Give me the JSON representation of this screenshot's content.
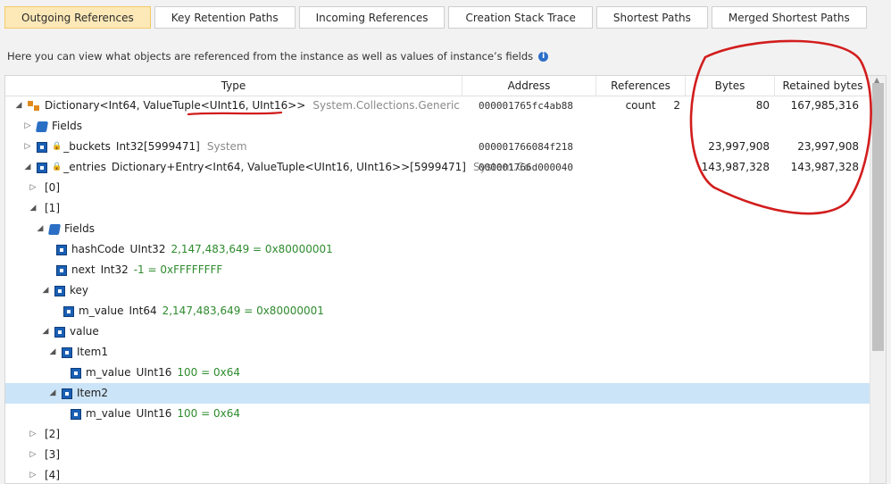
{
  "tabs": [
    {
      "label": "Outgoing References",
      "active": true
    },
    {
      "label": "Key Retention Paths",
      "active": false
    },
    {
      "label": "Incoming References",
      "active": false
    },
    {
      "label": "Creation Stack Trace",
      "active": false
    },
    {
      "label": "Shortest Paths",
      "active": false
    },
    {
      "label": "Merged Shortest Paths",
      "active": false
    }
  ],
  "description": "Here you can view what objects are referenced from the instance as well as values of instance’s fields",
  "info_icon": "i",
  "columns": {
    "type": "Type",
    "address": "Address",
    "refs": "References count",
    "bytes": "Bytes",
    "retained": "Retained bytes"
  },
  "rows": {
    "r0": {
      "name": "Dictionary<Int64, ValueTuple<UInt16, UInt16>>",
      "ns": "System.Collections.Generic",
      "address": "000001765fc4ab88",
      "refs": "2",
      "bytes": "80",
      "retained": "167,985,316"
    },
    "r1": {
      "name": "Fields"
    },
    "r2": {
      "name": "_buckets",
      "type": "Int32[5999471]",
      "ns": "System",
      "address": "000001766084f218",
      "bytes": "23,997,908",
      "retained": "23,997,908"
    },
    "r3": {
      "name": "_entries",
      "type": "Dictionary+Entry<Int64, ValueTuple<UInt16, UInt16>>[5999471]",
      "ns": "System.Co",
      "address": "000001766d000040",
      "bytes": "143,987,328",
      "retained": "143,987,328"
    },
    "r4": {
      "name": "[0]"
    },
    "r5": {
      "name": "[1]"
    },
    "r6": {
      "name": "Fields"
    },
    "r7": {
      "name": "hashCode",
      "type": "UInt32",
      "value": "2,147,483,649 = 0x80000001"
    },
    "r8": {
      "name": "next",
      "type": "Int32",
      "value": "-1 = 0xFFFFFFFF"
    },
    "r9": {
      "name": "key"
    },
    "r10": {
      "name": "m_value",
      "type": "Int64",
      "value": "2,147,483,649 = 0x80000001"
    },
    "r11": {
      "name": "value"
    },
    "r12": {
      "name": "Item1"
    },
    "r13": {
      "name": "m_value",
      "type": "UInt16",
      "value": "100 = 0x64"
    },
    "r14": {
      "name": "Item2"
    },
    "r15": {
      "name": "m_value",
      "type": "UInt16",
      "value": "100 = 0x64"
    },
    "r16": {
      "name": "[2]"
    },
    "r17": {
      "name": "[3]"
    },
    "r18": {
      "name": "[4]"
    }
  },
  "colors": {
    "active_tab": "#fde9b8",
    "selected_row": "#cce4f7",
    "value_text": "#2e8b2e",
    "namespace_text": "#8a8a8a",
    "annotation_red": "#d21d1d"
  }
}
